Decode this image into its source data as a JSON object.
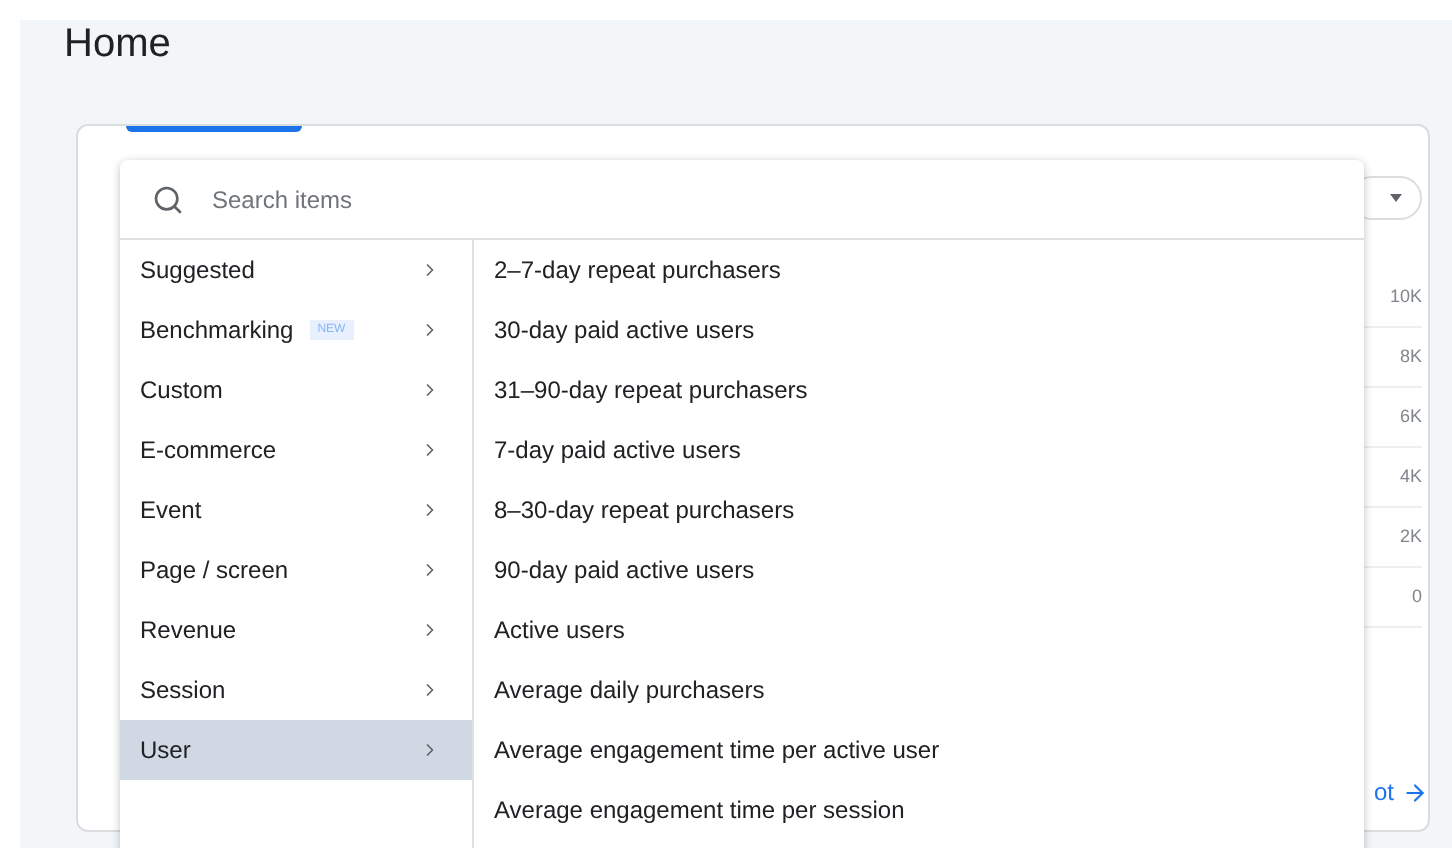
{
  "page": {
    "title": "Home"
  },
  "card": {
    "link": "ot",
    "axis_labels": [
      "10K",
      "8K",
      "6K",
      "4K",
      "2K",
      "0"
    ]
  },
  "menu": {
    "search": {
      "placeholder": "Search items"
    },
    "categories": [
      {
        "label": "Suggested",
        "selected": false
      },
      {
        "label": "Benchmarking",
        "badge": "NEW",
        "selected": false
      },
      {
        "label": "Custom",
        "selected": false
      },
      {
        "label": "E-commerce",
        "selected": false
      },
      {
        "label": "Event",
        "selected": false
      },
      {
        "label": "Page / screen",
        "selected": false
      },
      {
        "label": "Revenue",
        "selected": false
      },
      {
        "label": "Session",
        "selected": false
      },
      {
        "label": "User",
        "selected": true
      }
    ],
    "items": [
      "2–7-day repeat purchasers",
      "30-day paid active users",
      "31–90-day repeat purchasers",
      "7-day paid active users",
      "8–30-day repeat purchasers",
      "90-day paid active users",
      "Active users",
      "Average daily purchasers",
      "Average engagement time per active user",
      "Average engagement time per session"
    ]
  }
}
